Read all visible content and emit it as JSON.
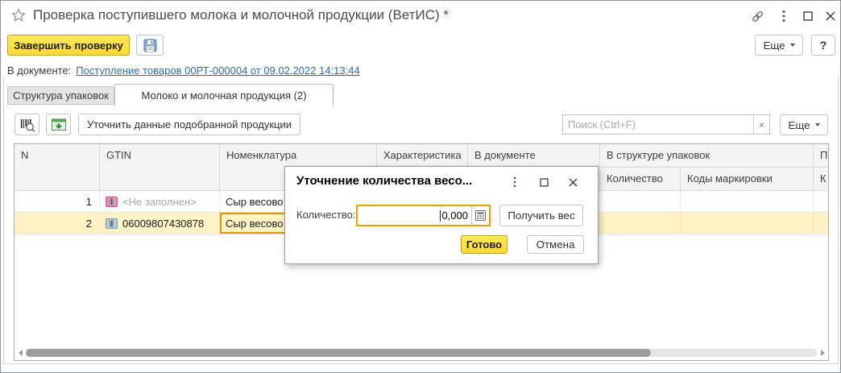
{
  "window": {
    "title": "Проверка поступившего молока и молочной продукции (ВетИС) *"
  },
  "commands": {
    "finish": "Завершить проверку",
    "more": "Еще",
    "help": "?"
  },
  "doc": {
    "label": "В документе:",
    "link": "Поступление товаров 00РТ-000004 от 09.02.2022 14:13:44"
  },
  "tabs": [
    {
      "label": "Структура упаковок",
      "active": false
    },
    {
      "label": "Молоко и молочная продукция (2)",
      "active": true
    }
  ],
  "toolbar": {
    "refine": "Уточнить данные подобранной продукции",
    "search_placeholder": "Поиск (Ctrl+F)",
    "clear": "×",
    "more": "Еще"
  },
  "table": {
    "headers": {
      "n": "N",
      "gtin": "GTIN",
      "nomenclature": "Номенклатура",
      "characteristic": "Характеристика",
      "in_document": "В документе",
      "in_packaging": "В структуре упаковок",
      "quantity": "Количество",
      "marking_codes": "Коды маркировки",
      "p": "П",
      "k": "К"
    },
    "rows": [
      {
        "n": "1",
        "gtin": "<Не заполнен>",
        "nomenclature": "Сыр весово"
      },
      {
        "n": "2",
        "gtin": "06009807430878",
        "nomenclature": "Сыр весово"
      }
    ]
  },
  "dialog": {
    "title": "Уточнение количества весо...",
    "quantity_label": "Количество:",
    "quantity_value": "0,000",
    "get_weight": "Получить вес",
    "done": "Готово",
    "cancel": "Отмена"
  },
  "colors": {
    "accent_yellow": "#ffdf33",
    "selected_row": "#fff3c5",
    "selected_cell_border": "#d89e00",
    "link_blue": "#2d6cb5"
  }
}
